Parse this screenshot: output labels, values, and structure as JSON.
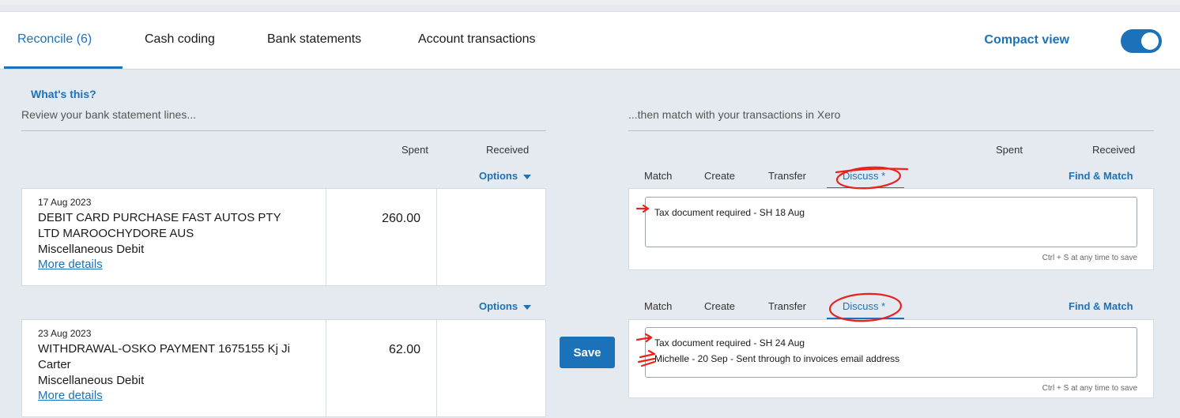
{
  "tabs": [
    {
      "label": "Reconcile (6)"
    },
    {
      "label": "Cash coding"
    },
    {
      "label": "Bank statements"
    },
    {
      "label": "Account transactions"
    }
  ],
  "compact_view": {
    "label": "Compact view",
    "enabled": true
  },
  "left": {
    "whats_this": "What's this?",
    "heading": "Review your bank statement lines...",
    "col_spent": "Spent",
    "col_received": "Received",
    "options_label": "Options"
  },
  "right": {
    "heading": "...then match with your transactions in Xero",
    "col_spent": "Spent",
    "col_received": "Received",
    "tabs": [
      "Match",
      "Create",
      "Transfer",
      "Discuss *"
    ],
    "find_match": "Find & Match",
    "hint": "Ctrl + S at any time to save"
  },
  "save_label": "Save",
  "rows": [
    {
      "date": "17 Aug 2023",
      "desc_line1": "DEBIT CARD PURCHASE FAST AUTOS PTY",
      "desc_line2": "LTD MAROOCHYDORE AUS",
      "reference": "Miscellaneous Debit",
      "more": "More details",
      "spent": "260.00",
      "received": "",
      "notes": [
        "Tax document required - SH 18 Aug"
      ]
    },
    {
      "date": "23 Aug 2023",
      "desc_line1": "WITHDRAWAL-OSKO PAYMENT 1675155 Kj Ji",
      "desc_line2": "Carter",
      "reference": "Miscellaneous Debit",
      "more": "More details",
      "spent": "62.00",
      "received": "",
      "notes": [
        "Tax document required - SH 24 Aug",
        "Michelle - 20 Sep - Sent through to invoices email address"
      ]
    }
  ],
  "colors": {
    "accent": "#1c72b8",
    "annotation": "#e8231c"
  }
}
